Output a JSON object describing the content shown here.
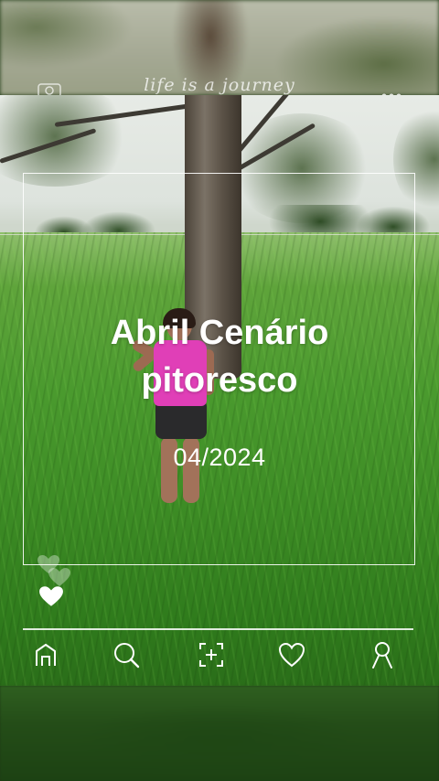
{
  "header": {
    "title": "life is a journey",
    "left_icon": "camera-icon",
    "right_icon": "more-dots-icon"
  },
  "card": {
    "title_line1": "Abril Cenário",
    "title_line2": "pitoresco",
    "date": "04/2024"
  },
  "reactions": {
    "icon": "heart-icon"
  },
  "nav": {
    "items": [
      {
        "name": "home",
        "icon": "home-icon"
      },
      {
        "name": "search",
        "icon": "search-icon"
      },
      {
        "name": "add",
        "icon": "add-photo-icon"
      },
      {
        "name": "favorites",
        "icon": "heart-outline-icon"
      },
      {
        "name": "profile",
        "icon": "profile-icon"
      }
    ]
  },
  "colors": {
    "overlay_text": "#ffffff",
    "grass": "#3d8c25",
    "shirt": "#e03fb7"
  }
}
